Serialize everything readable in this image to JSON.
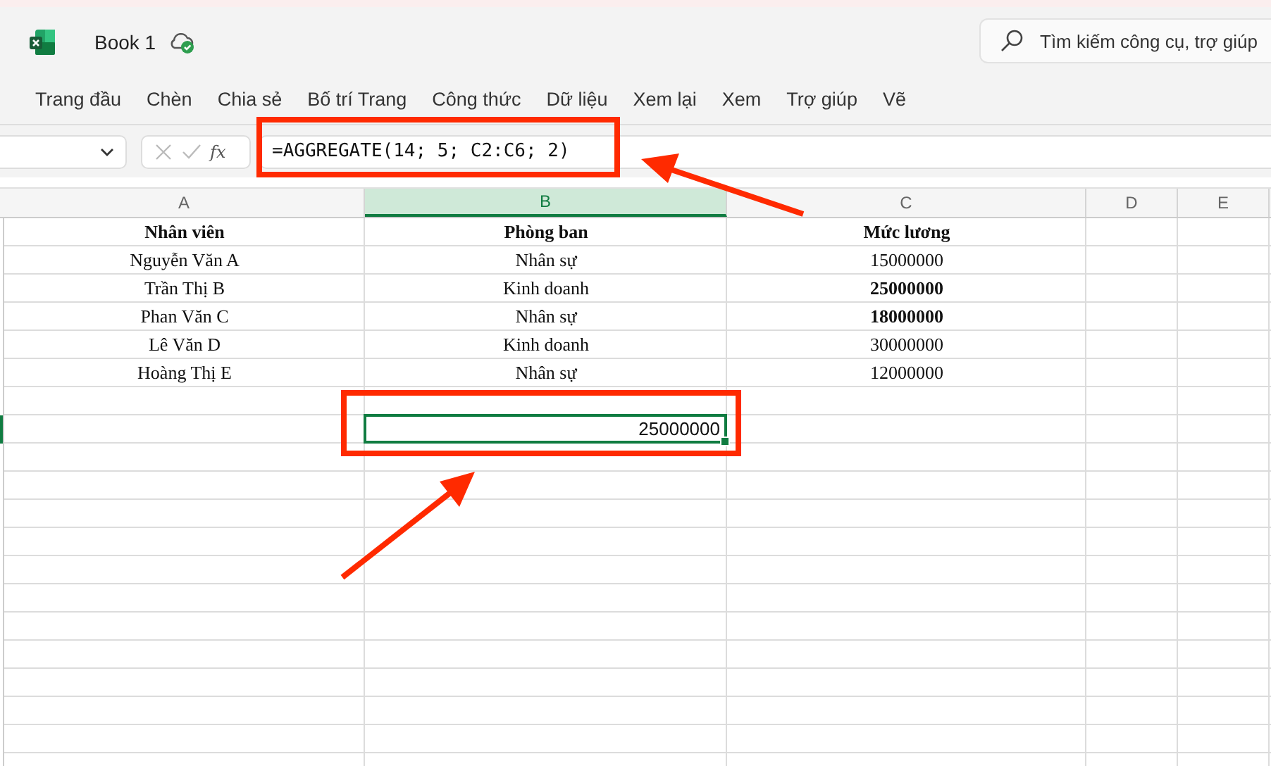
{
  "title_bar": {
    "file_name": "Book 1",
    "search": {
      "placeholder": "Tìm kiếm công cụ, trợ giúp"
    }
  },
  "ribbon_tabs": [
    {
      "label": "Trang đầu",
      "selected": false
    },
    {
      "label": "Chèn",
      "selected": false
    },
    {
      "label": "Chia sẻ",
      "selected": false
    },
    {
      "label": "Bố trí Trang",
      "selected": false
    },
    {
      "label": "Công thức",
      "selected": false
    },
    {
      "label": "Dữ liệu",
      "selected": false
    },
    {
      "label": "Xem lại",
      "selected": false
    },
    {
      "label": "Xem",
      "selected": false
    },
    {
      "label": "Trợ giúp",
      "selected": false
    },
    {
      "label": "Vẽ",
      "selected": false
    }
  ],
  "formula_bar": {
    "fx": "fx",
    "formula": "=AGGREGATE(14; 5; C2:C6; 2)"
  },
  "columns": [
    {
      "label": "A",
      "selected": false
    },
    {
      "label": "B",
      "selected": true
    },
    {
      "label": "C",
      "selected": false
    },
    {
      "label": "D",
      "selected": false
    },
    {
      "label": "E",
      "selected": false
    }
  ],
  "rows": [
    {
      "cells": [
        {
          "text": "Nhân viên",
          "bold": true
        },
        {
          "text": "Phòng ban",
          "bold": true
        },
        {
          "text": "Mức lương",
          "bold": true
        }
      ]
    },
    {
      "cells": [
        {
          "text": "Nguyễn Văn A",
          "bold": false
        },
        {
          "text": "Nhân sự",
          "bold": false
        },
        {
          "text": "15000000",
          "bold": false
        }
      ]
    },
    {
      "cells": [
        {
          "text": "Trần Thị B",
          "bold": false
        },
        {
          "text": "Kinh doanh",
          "bold": false
        },
        {
          "text": "25000000",
          "bold": true
        }
      ]
    },
    {
      "cells": [
        {
          "text": "Phan Văn C",
          "bold": false
        },
        {
          "text": "Nhân sự",
          "bold": false
        },
        {
          "text": "18000000",
          "bold": true
        }
      ]
    },
    {
      "cells": [
        {
          "text": "Lê Văn D",
          "bold": false
        },
        {
          "text": "Kinh doanh",
          "bold": false
        },
        {
          "text": "30000000",
          "bold": false
        }
      ]
    },
    {
      "cells": [
        {
          "text": "Hoàng Thị E",
          "bold": false
        },
        {
          "text": "Nhân sự",
          "bold": false
        },
        {
          "text": "12000000",
          "bold": false
        }
      ]
    }
  ],
  "result_cell": {
    "text": "25000000",
    "selected": true
  }
}
